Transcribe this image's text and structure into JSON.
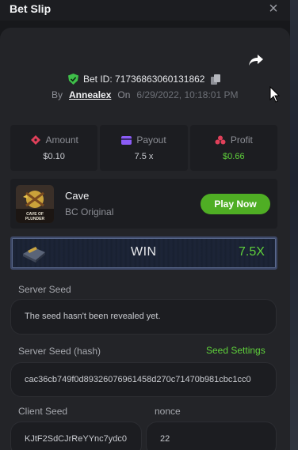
{
  "header": {
    "title": "Bet Slip",
    "close_label": "×"
  },
  "bet": {
    "id_label": "Bet ID: 717368630601318​62",
    "by_label": "By",
    "user": "Annealex",
    "on_label": "On",
    "date": "6/29/2022, 10:18:01 PM"
  },
  "stats": [
    {
      "label": "Amount",
      "value": "$0.10"
    },
    {
      "label": "Payout",
      "value": "7.5 x"
    },
    {
      "label": "Profit",
      "value": "$0.66"
    }
  ],
  "game": {
    "name": "Cave",
    "subtitle": "BC Original",
    "play_label": "Play Now",
    "thumb_text": "CAVE OF PLUNDER"
  },
  "result": {
    "label": "WIN",
    "multiplier": "7.5X"
  },
  "fairness": {
    "server_seed_label": "Server Seed",
    "server_seed_value": "The seed hasn't been revealed yet.",
    "server_hash_label": "Server Seed (hash)",
    "seed_settings_label": "Seed Settings",
    "server_hash_value": "cac36cb749f0d89326076961458d270c71470b981cbc1cc0",
    "client_seed_label": "Client Seed",
    "client_seed_value": "KJtF2SdCJrReYYnc7ydc0",
    "nonce_label": "nonce",
    "nonce_value": "22"
  },
  "colors": {
    "accent": "#5fd13b",
    "button": "#4fae24",
    "panel": "#232428",
    "card": "#1c1d21"
  }
}
